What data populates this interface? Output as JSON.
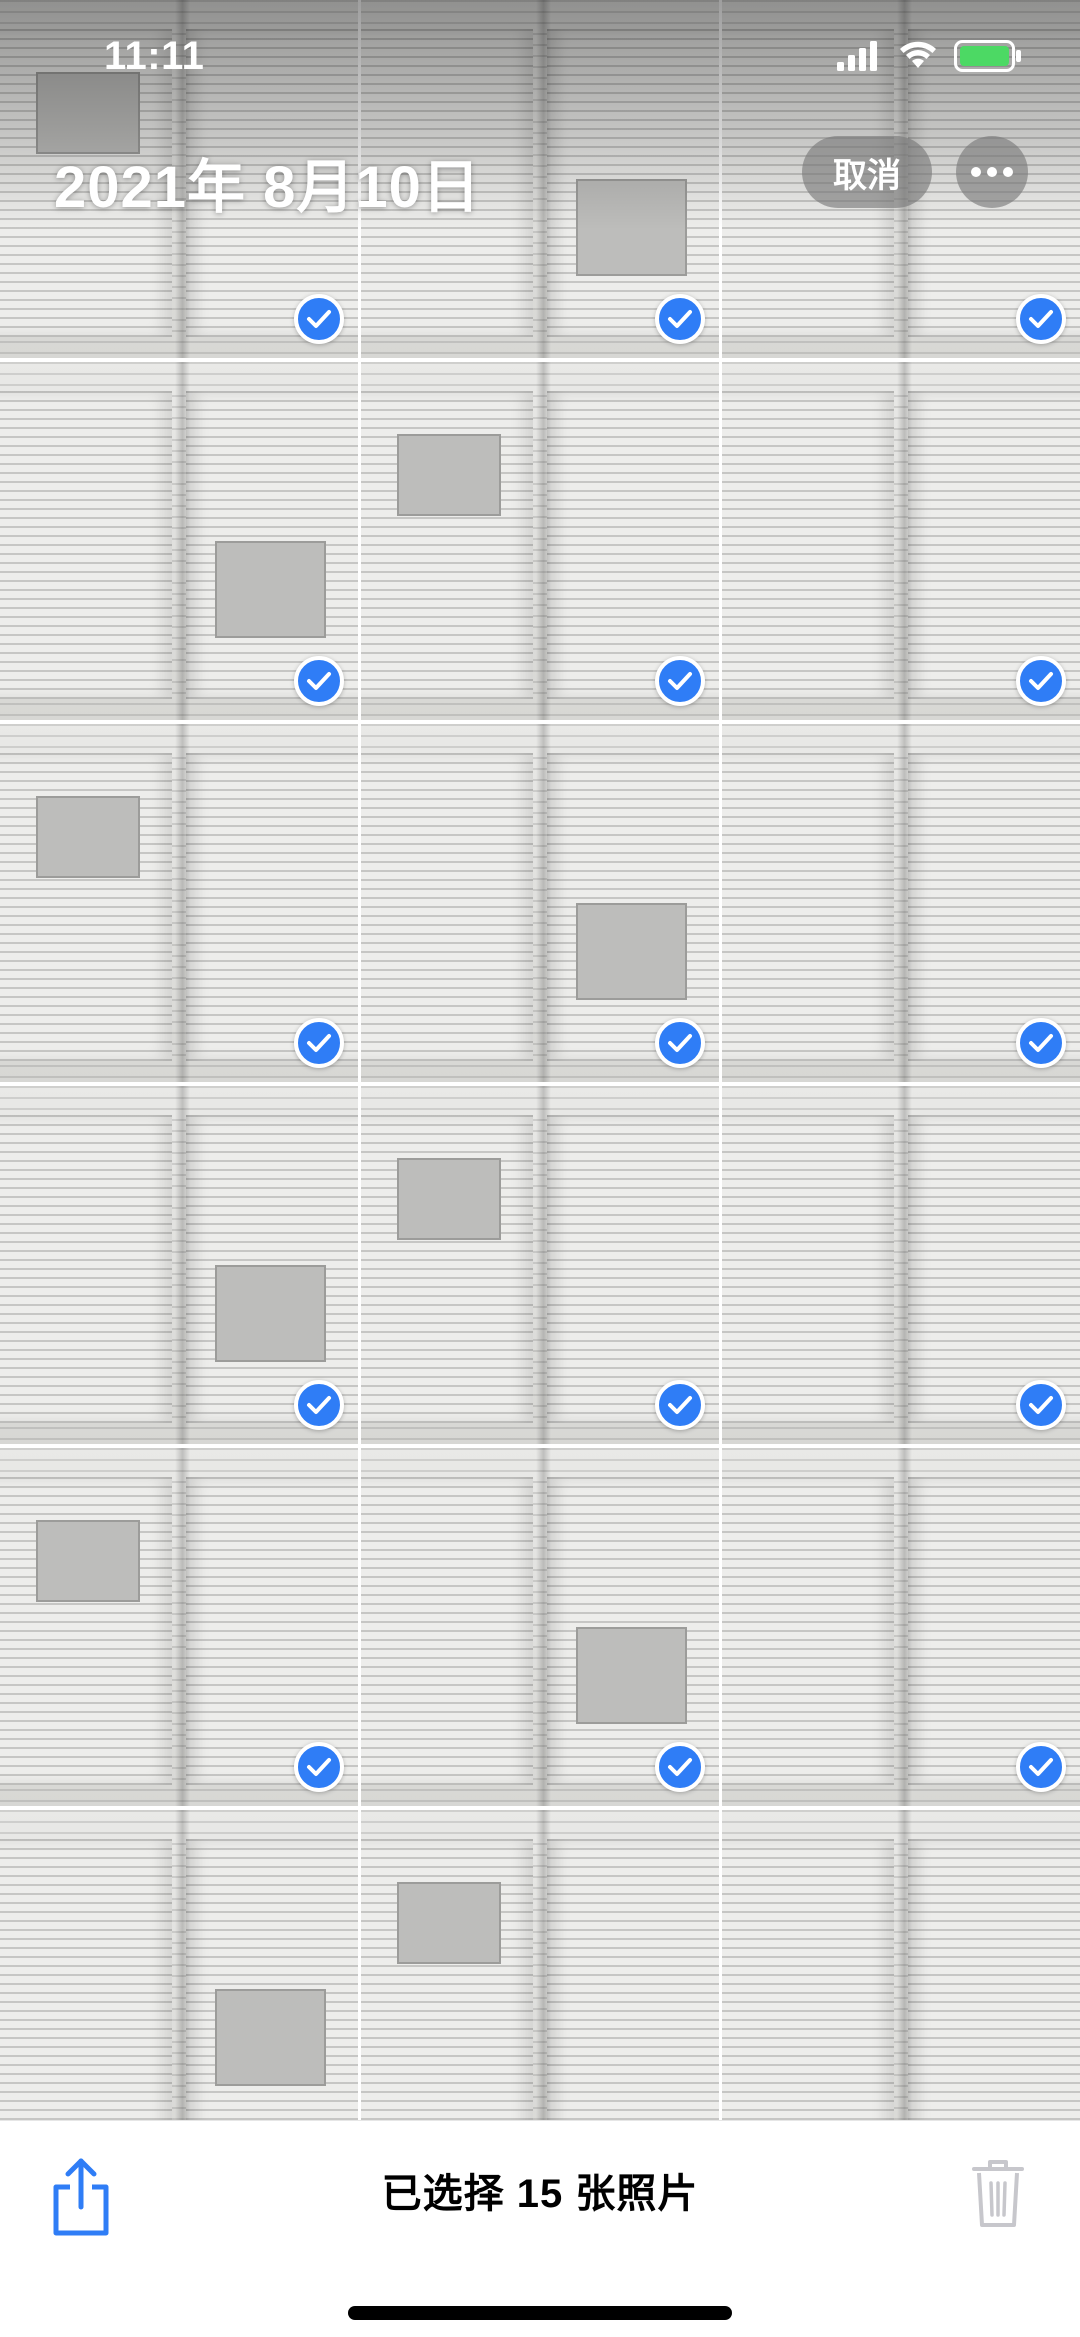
{
  "status_bar": {
    "time": "11:11",
    "signal_icon": "cellular-signal-icon",
    "wifi_icon": "wifi-icon",
    "battery_icon": "battery-icon",
    "battery_color": "#4cd964"
  },
  "header": {
    "title": "2021年 8月10日",
    "cancel_label": "取消",
    "more_icon": "ellipsis-icon"
  },
  "grid": {
    "columns": 3,
    "photos": [
      {
        "selected": true
      },
      {
        "selected": true
      },
      {
        "selected": true
      },
      {
        "selected": true
      },
      {
        "selected": true
      },
      {
        "selected": true
      },
      {
        "selected": true
      },
      {
        "selected": true
      },
      {
        "selected": true
      },
      {
        "selected": true
      },
      {
        "selected": true
      },
      {
        "selected": true
      },
      {
        "selected": true
      },
      {
        "selected": true
      },
      {
        "selected": true
      },
      {
        "selected": false
      },
      {
        "selected": false
      },
      {
        "selected": false
      }
    ],
    "check_color": "#2f7df6"
  },
  "toolbar": {
    "share_icon": "share-icon",
    "selection_count": "已选择 15 张照片",
    "trash_icon": "trash-icon",
    "accent_color": "#2f7df6"
  }
}
